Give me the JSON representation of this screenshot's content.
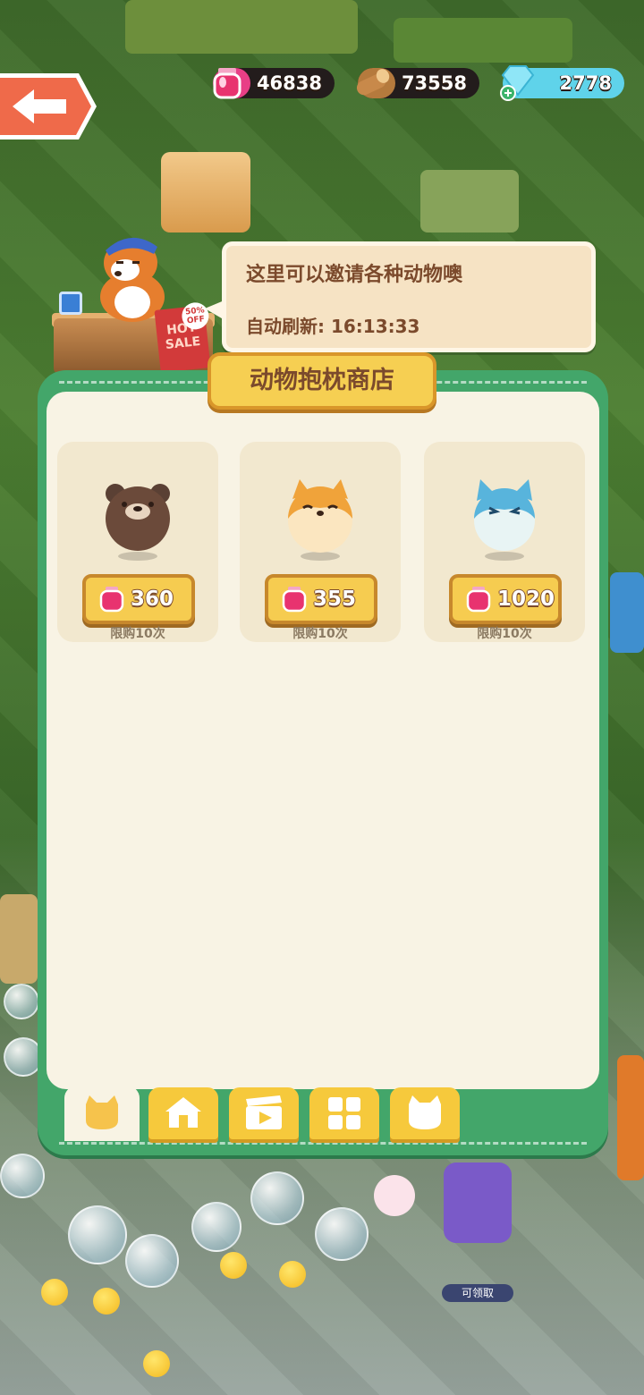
{
  "resources": {
    "potion": {
      "value": "46838",
      "icon": "potion-jar-icon",
      "color": "#e83f86"
    },
    "wood": {
      "value": "73558",
      "icon": "wood-log-icon",
      "color": "#b57a3d"
    },
    "gems": {
      "value": "2778",
      "icon": "diamond-plus-icon",
      "color": "#5fd3ea"
    }
  },
  "speech": {
    "line1": "这里可以邀请各种动物噢",
    "refresh_label": "自动刷新:",
    "refresh_time": "16:13:33"
  },
  "shop": {
    "title": "动物抱枕商店",
    "items": [
      {
        "pet": "bear-pillow",
        "price": "360",
        "limit": "限购10次"
      },
      {
        "pet": "shiba-pillow",
        "price": "355",
        "limit": "限购10次"
      },
      {
        "pet": "blue-cat-pillow",
        "price": "1020",
        "limit": "限购10次"
      }
    ]
  },
  "tabs": [
    {
      "icon": "cat-icon",
      "active": true
    },
    {
      "icon": "house-icon",
      "active": false
    },
    {
      "icon": "video-icon",
      "active": false
    },
    {
      "icon": "grid-icon",
      "active": false
    },
    {
      "icon": "cat-icon",
      "active": false
    }
  ],
  "scene": {
    "claim_label": "可领取"
  },
  "colors": {
    "panel": "#43a66a",
    "panel_inner": "#f8f3e4",
    "button": "#f6cc50"
  }
}
